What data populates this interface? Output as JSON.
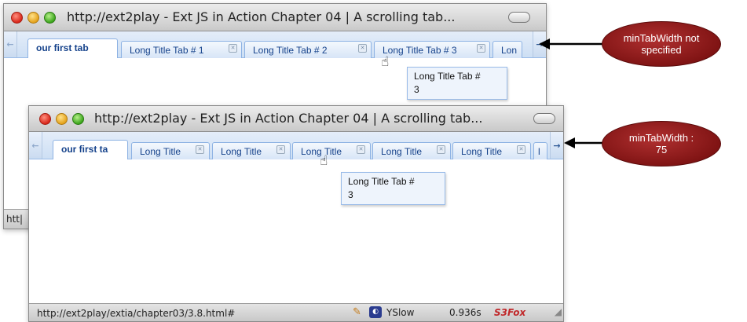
{
  "window1": {
    "title": "http://ext2play - Ext JS in Action Chapter 04 | A scrolling tab...",
    "tabs": [
      {
        "label": "our first tab",
        "active": true,
        "closable": false
      },
      {
        "label": "Long Title Tab # 1",
        "closable": true
      },
      {
        "label": "Long Title Tab # 2",
        "closable": true
      },
      {
        "label": "Long Title Tab # 3",
        "closable": true
      },
      {
        "label": "Lon",
        "closable": false
      }
    ],
    "tooltip_line1": "Long Title Tab #",
    "tooltip_line2": "3",
    "status_fragment": "htt|",
    "scroll_left": "←",
    "scroll_right": "→"
  },
  "window2": {
    "title": "http://ext2play - Ext JS in Action Chapter 04 | A scrolling tab...",
    "tabs": [
      {
        "label": "our first ta",
        "active": true,
        "closable": false
      },
      {
        "label": "Long Title",
        "closable": true
      },
      {
        "label": "Long Title",
        "closable": true
      },
      {
        "label": "Long Title",
        "closable": true
      },
      {
        "label": "Long Title",
        "closable": true
      },
      {
        "label": "Long Title",
        "closable": true
      },
      {
        "label": "l",
        "closable": false
      }
    ],
    "tooltip_line1": "Long Title Tab #",
    "tooltip_line2": "3",
    "status_url": "http://ext2play/extia/chapter03/3.8.html#",
    "yslow_label": "YSlow",
    "load_time": "0.936s",
    "s3fox_label": "S3Fox",
    "scroll_left": "←",
    "scroll_right": "→"
  },
  "annotations": {
    "top_line1": "minTabWidth not",
    "top_line2": "specified",
    "bottom_line1": "minTabWidth :",
    "bottom_line2": "75"
  },
  "colors": {
    "tab_text": "#15428b",
    "annotation_fill": "#8b1a1a",
    "tab_border": "#8db2e3"
  }
}
